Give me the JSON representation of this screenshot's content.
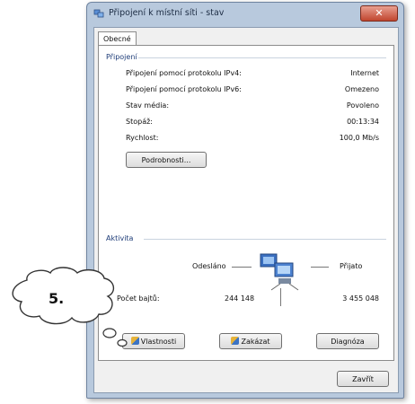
{
  "window": {
    "title": "Připojení k místní síti - stav",
    "close_glyph": "✕",
    "icon": "network-icon"
  },
  "tabs": [
    {
      "label": "Obecné",
      "selected": true
    }
  ],
  "connection": {
    "heading": "Připojení",
    "rows": [
      {
        "label": "Připojení pomocí protokolu IPv4:",
        "value": "Internet"
      },
      {
        "label": "Připojení pomocí protokolu IPv6:",
        "value": "Omezeno"
      },
      {
        "label": "Stav média:",
        "value": "Povoleno"
      },
      {
        "label": "Stopáž:",
        "value": "00:13:34"
      },
      {
        "label": "Rychlost:",
        "value": "100,0 Mb/s"
      }
    ],
    "details_button": "Podrobnosti..."
  },
  "activity": {
    "heading": "Aktivita",
    "sent_label": "Odesláno",
    "received_label": "Přijato",
    "bytes_label": "Počet bajtů:",
    "bytes_sent": "244 148",
    "bytes_received": "3 455 048"
  },
  "buttons": {
    "properties": "Vlastnosti",
    "disable": "Zakázat",
    "diagnose": "Diagnóza",
    "close": "Zavřít"
  },
  "callout": {
    "number": "5."
  },
  "colors": {
    "window_frame": "#b8c9dd",
    "heading": "#1e3c78",
    "close_red": "#c0452f"
  }
}
